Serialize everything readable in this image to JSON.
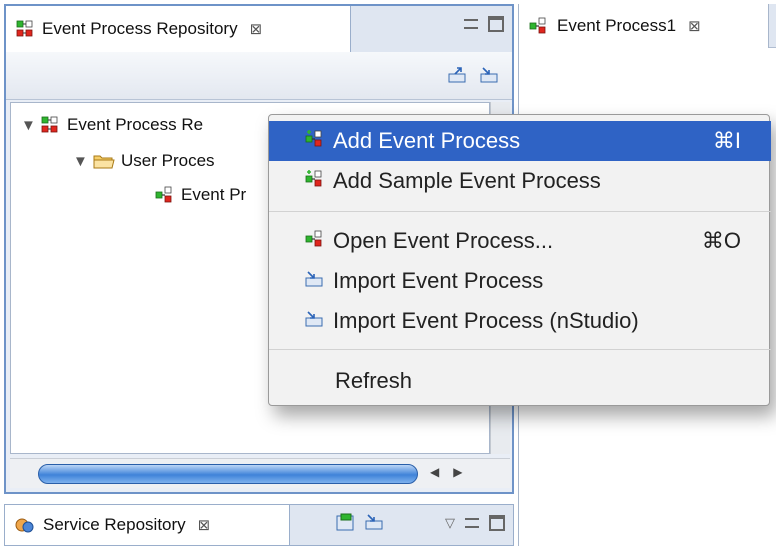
{
  "left_view": {
    "tab_title": "Event Process Repository",
    "close_glyph": "⊠",
    "tree": {
      "root": "Event Process Re",
      "folder": "User Proces",
      "item": "Event Pr"
    },
    "toolbar_icons": [
      "export-icon",
      "import-icon"
    ]
  },
  "bottom_view": {
    "tab_title": "Service Repository",
    "close_glyph": "⊠",
    "chevron": "▽"
  },
  "editor": {
    "tab_title": "Event Process1",
    "close_glyph": "⊠"
  },
  "context_menu": {
    "items": [
      {
        "label": "Add Event Process",
        "shortcut": "⌘I",
        "icon": "add-process-icon",
        "selected": true
      },
      {
        "label": "Add Sample Event Process",
        "shortcut": "",
        "icon": "add-sample-icon"
      },
      {
        "label": "Open Event Process...",
        "shortcut": "⌘O",
        "icon": "event-process-icon"
      },
      {
        "label": "Import Event Process",
        "shortcut": "",
        "icon": "import-icon"
      },
      {
        "label": "Import Event Process (nStudio)",
        "shortcut": "",
        "icon": "import-icon"
      },
      {
        "label": "Refresh",
        "shortcut": "",
        "icon": ""
      }
    ]
  },
  "colors": {
    "selection": "#2f63c5",
    "view_border": "#6e93c8",
    "scroll_thumb": "#3f83d9"
  }
}
